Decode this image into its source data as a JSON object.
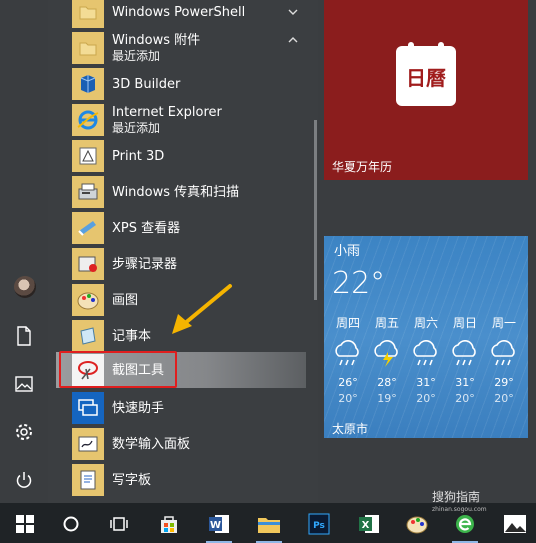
{
  "applist": {
    "items": [
      {
        "label": "Windows PowerShell",
        "icon": "folder-icon",
        "chevron": "down"
      },
      {
        "label": "Windows 附件",
        "sub": "最近添加",
        "icon": "folder-icon",
        "chevron": "up"
      },
      {
        "label": "3D Builder",
        "icon": "3d-builder-icon"
      },
      {
        "label": "Internet Explorer",
        "sub": "最近添加",
        "icon": "internet-explorer-icon"
      },
      {
        "label": "Print 3D",
        "icon": "print-3d-icon"
      },
      {
        "label": "Windows 传真和扫描",
        "icon": "fax-scan-icon"
      },
      {
        "label": "XPS 查看器",
        "icon": "xps-viewer-icon"
      },
      {
        "label": "步骤记录器",
        "icon": "steps-recorder-icon"
      },
      {
        "label": "画图",
        "icon": "paint-icon"
      },
      {
        "label": "记事本",
        "icon": "notepad-icon"
      },
      {
        "label": "截图工具",
        "icon": "snipping-tool-icon"
      },
      {
        "label": "快速助手",
        "icon": "quick-assist-icon"
      },
      {
        "label": "数学输入面板",
        "icon": "math-input-icon"
      },
      {
        "label": "写字板",
        "icon": "wordpad-icon"
      }
    ]
  },
  "tiles": {
    "calendar": {
      "label": "华夏万年历",
      "glyph": "日曆",
      "color": "#8b1d1d"
    },
    "weather": {
      "condition": "小雨",
      "temp": "22°",
      "city": "太原市",
      "days": [
        {
          "day": "周四",
          "hi": "26°",
          "lo": "20°",
          "icon": "rain-icon"
        },
        {
          "day": "周五",
          "hi": "28°",
          "lo": "19°",
          "icon": "thunder-rain-icon"
        },
        {
          "day": "周六",
          "hi": "31°",
          "lo": "20°",
          "icon": "rain-icon"
        },
        {
          "day": "周日",
          "hi": "31°",
          "lo": "20°",
          "icon": "rain-icon"
        },
        {
          "day": "周一",
          "hi": "29°",
          "lo": "20°",
          "icon": "rain-icon"
        }
      ]
    }
  },
  "watermark": {
    "text": "搜狗指南",
    "url": "zhinan.sogou.com"
  },
  "colors": {
    "accent_tile": "#e6c56f",
    "highlight_border": "#e01e1e",
    "arrow": "#f5b400"
  }
}
